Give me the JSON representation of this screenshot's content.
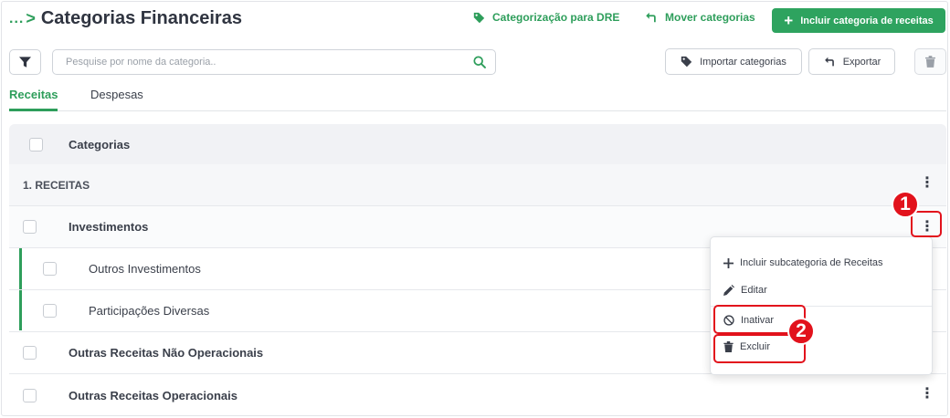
{
  "header": {
    "breadcrumb": "...",
    "breadcrumb_sep": ">",
    "title": "Categorias Financeiras",
    "actions": {
      "dre_label": "Categorização para DRE",
      "move_label": "Mover categorias",
      "add_label": "Incluir categoria de receitas"
    }
  },
  "toolbar": {
    "search_placeholder": "Pesquise por nome da categoria..",
    "import_label": "Importar categorias",
    "export_label": "Exportar"
  },
  "tabs": [
    {
      "label": "Receitas",
      "active": true
    },
    {
      "label": "Despesas",
      "active": false
    }
  ],
  "table": {
    "header": "Categorias",
    "rows": [
      {
        "label": "1. RECEITAS",
        "level": "group"
      },
      {
        "label": "Investimentos",
        "level": 1
      },
      {
        "label": "Outros Investimentos",
        "level": 2
      },
      {
        "label": "Participações Diversas",
        "level": 2
      },
      {
        "label": "Outras Receitas Não Operacionais",
        "level": 1
      },
      {
        "label": "Outras Receitas Operacionais",
        "level": 1
      }
    ]
  },
  "context_menu": {
    "items": [
      {
        "label": "Incluir subcategoria de Receitas",
        "icon": "plus-icon"
      },
      {
        "label": "Editar",
        "icon": "pencil-icon"
      },
      {
        "label": "Inativar",
        "icon": "ban-icon"
      },
      {
        "label": "Excluir",
        "icon": "trash-icon"
      }
    ]
  },
  "annotations": {
    "step1": "1",
    "step2": "2"
  },
  "colors": {
    "accent": "#2e9e5b",
    "annotation": "#e2121c"
  }
}
